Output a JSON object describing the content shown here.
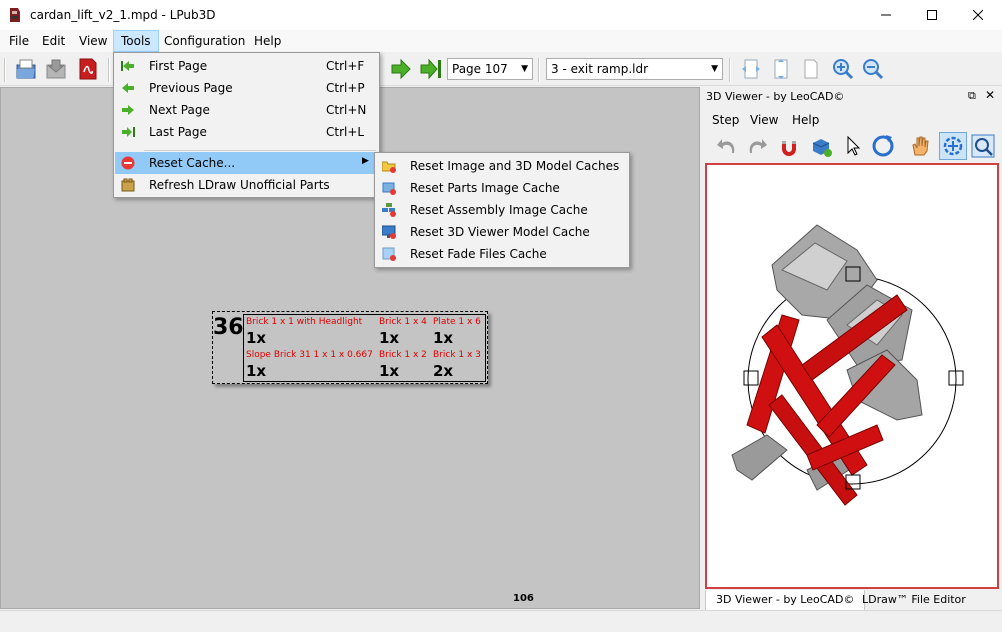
{
  "window": {
    "title": "cardan_lift_v2_1.mpd - LPub3D"
  },
  "menubar": {
    "items": [
      "File",
      "Edit",
      "View",
      "Tools",
      "Configuration",
      "Help"
    ]
  },
  "toolbar": {
    "page_combo": "Page 107",
    "submodel_combo": "3 - exit ramp.ldr"
  },
  "tools_menu": {
    "items": [
      {
        "label": "First Page",
        "shortcut": "Ctrl+F",
        "icon": "first-page-icon"
      },
      {
        "label": "Previous Page",
        "shortcut": "Ctrl+P",
        "icon": "previous-page-icon"
      },
      {
        "label": "Next Page",
        "shortcut": "Ctrl+N",
        "icon": "next-page-icon"
      },
      {
        "label": "Last Page",
        "shortcut": "Ctrl+L",
        "icon": "last-page-icon"
      },
      {
        "label": "Reset Cache...",
        "shortcut": "",
        "icon": "reset-cache-icon"
      },
      {
        "label": "Refresh LDraw Unofficial Parts",
        "shortcut": "",
        "icon": "refresh-parts-icon"
      }
    ]
  },
  "reset_submenu": {
    "items": [
      "Reset Image and 3D Model Caches",
      "Reset Parts Image Cache",
      "Reset Assembly Image Cache",
      "Reset 3D Viewer Model Cache",
      "Reset Fade Files Cache"
    ]
  },
  "page": {
    "step_number": "36",
    "page_number": "106",
    "parts": [
      {
        "name": "Brick 1 x 1 with Headlight",
        "qty": "1x"
      },
      {
        "name": "Brick 1 x 4",
        "qty": "1x"
      },
      {
        "name": "Plate 1 x 6",
        "qty": "1x"
      },
      {
        "name": "Slope Brick 31 1 x 1 x 0.667",
        "qty": "1x"
      },
      {
        "name": "Brick 1 x 2",
        "qty": "1x"
      },
      {
        "name": "Brick 1 x 3",
        "qty": "2x"
      }
    ]
  },
  "viewer": {
    "title": "3D Viewer - by LeoCAD©",
    "menu": [
      "Step",
      "View",
      "Help"
    ],
    "tabs": [
      "3D Viewer - by LeoCAD©",
      "LDraw™ File Editor"
    ]
  },
  "colors": {
    "accent": "#91c9f7",
    "part_red": "#e00000",
    "model_red": "#d01010",
    "model_gray": "#909090"
  }
}
